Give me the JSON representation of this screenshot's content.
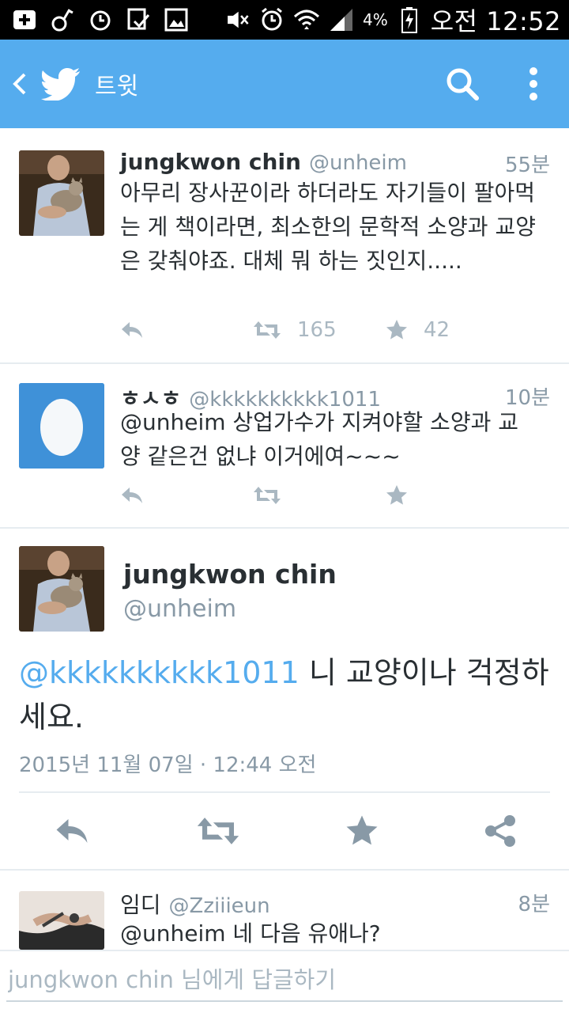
{
  "status_bar": {
    "battery_percent": "4%",
    "time": "오전 12:52"
  },
  "app_bar": {
    "title": "트윗",
    "accent_color": "#55acee"
  },
  "tweets": [
    {
      "name": "jungkwon chin",
      "handle": "@unheim",
      "time": "55분",
      "text": "아무리 장사꾼이라 하더라도 자기들이 팔아먹는 게 책이라면, 최소한의 문학적 소양과 교양은 갖춰야죠. 대체 뭐 하는 짓인지.....",
      "retweets": "165",
      "favorites": "42"
    },
    {
      "name": "ㅎㅅㅎ",
      "handle": "@kkkkkkkkkk1011",
      "time": "10분",
      "text": "@unheim 상업가수가 지켜야할 소양과 교양 같은건 없냐 이거에여~~~"
    }
  ],
  "detail": {
    "name": "jungkwon chin",
    "handle": "@unheim",
    "mention": "@kkkkkkkkkk1011",
    "text": " 니 교양이나 걱정하세요.",
    "date": "2015년 11월 07일 · 12:44 오전"
  },
  "reply": {
    "name": "임디",
    "handle": "@Zziiieun",
    "time": "8분",
    "text": "@unheim 네 다음 유애나?"
  },
  "reply_bar": {
    "placeholder": "jungkwon chin 님에게 답글하기"
  }
}
